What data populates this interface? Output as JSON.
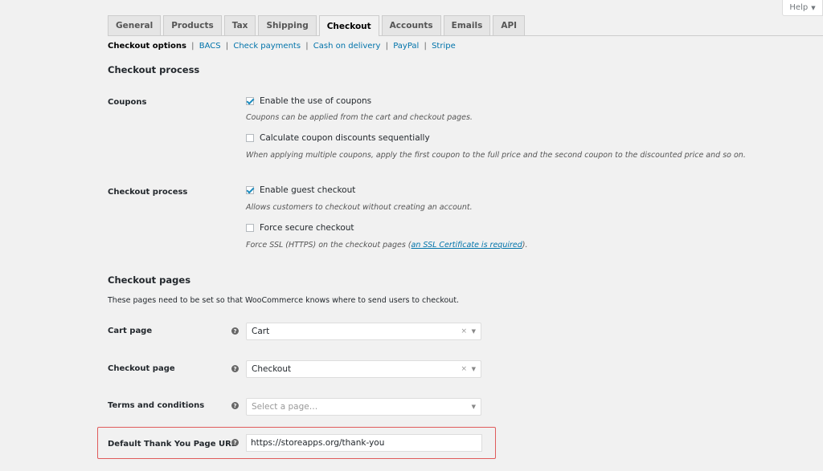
{
  "help_tab": {
    "label": "Help",
    "caret": "▼"
  },
  "tabs": [
    {
      "label": "General",
      "active": false
    },
    {
      "label": "Products",
      "active": false
    },
    {
      "label": "Tax",
      "active": false
    },
    {
      "label": "Shipping",
      "active": false
    },
    {
      "label": "Checkout",
      "active": true
    },
    {
      "label": "Accounts",
      "active": false
    },
    {
      "label": "Emails",
      "active": false
    },
    {
      "label": "API",
      "active": false
    }
  ],
  "subsections": {
    "current": "Checkout options",
    "links": [
      "BACS",
      "Check payments",
      "Cash on delivery",
      "PayPal",
      "Stripe"
    ],
    "separator": "|"
  },
  "checkout_process_section": {
    "title": "Checkout process",
    "coupons": {
      "label": "Coupons",
      "enable_coupons": {
        "label": "Enable the use of coupons",
        "checked": true,
        "desc": "Coupons can be applied from the cart and checkout pages."
      },
      "sequential": {
        "label": "Calculate coupon discounts sequentially",
        "checked": false,
        "desc": "When applying multiple coupons, apply the first coupon to the full price and the second coupon to the discounted price and so on."
      }
    },
    "checkout": {
      "label": "Checkout process",
      "guest": {
        "label": "Enable guest checkout",
        "checked": true,
        "desc": "Allows customers to checkout without creating an account."
      },
      "secure": {
        "label": "Force secure checkout",
        "checked": false,
        "desc_prefix": "Force SSL (HTTPS) on the checkout pages (",
        "desc_link": "an SSL Certificate is required",
        "desc_suffix": ")."
      }
    }
  },
  "checkout_pages_section": {
    "title": "Checkout pages",
    "note": "These pages need to be set so that WooCommerce knows where to send users to checkout.",
    "help_glyph": "?",
    "cart": {
      "label": "Cart page",
      "value": "Cart",
      "clear": "×",
      "arrow": "▼"
    },
    "checkout": {
      "label": "Checkout page",
      "value": "Checkout",
      "clear": "×",
      "arrow": "▼"
    },
    "terms": {
      "label": "Terms and conditions",
      "placeholder": "Select a page…",
      "arrow": "▼"
    },
    "thank_you": {
      "label": "Default Thank You Page URL",
      "value": "https://storeapps.org/thank-you"
    }
  },
  "colors": {
    "highlight": "#e05b5b",
    "link": "#0073aa",
    "checkmark": "#1e8cbe"
  }
}
